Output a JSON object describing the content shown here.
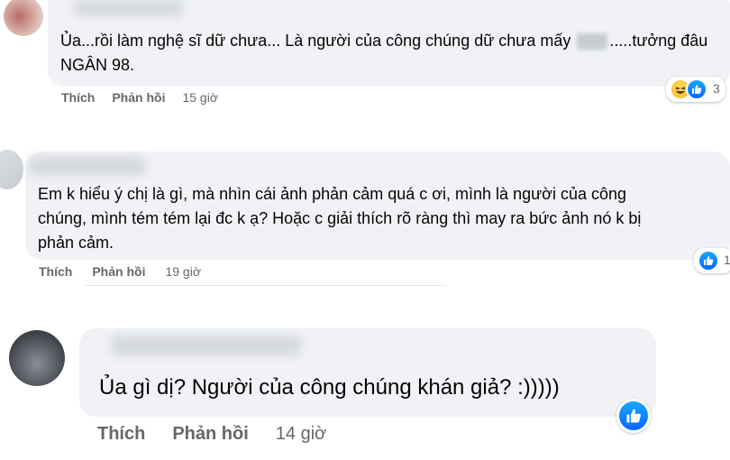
{
  "comments": [
    {
      "text_line1": "Ủa...rồi làm nghệ sĩ dữ chưa... Là người của công chúng dữ chưa mấy",
      "text_line1_after": ".....tưởng đâu",
      "text_line2": "NGÂN 98.",
      "like_label": "Thích",
      "reply_label": "Phản hồi",
      "time": "15 giờ",
      "reactions": [
        "haha",
        "like"
      ],
      "reaction_count": "3"
    },
    {
      "text_line1": "Em k hiểu ý chị là gì, mà nhìn cái ảnh phản cảm quá c ơi, mình là người của công",
      "text_line2": "chúng, mình tém tém lại đc k ạ? Hoặc c giải thích rõ ràng thì may ra bức ảnh nó k bị",
      "text_line3": "phản cảm.",
      "like_label": "Thích",
      "reply_label": "Phản hồi",
      "time": "19 giờ",
      "reactions": [
        "like"
      ],
      "reaction_count": "1"
    },
    {
      "text_line1": "Ủa gì dị? Người của công chúng khán giả? :)))))",
      "like_label": "Thích",
      "reply_label": "Phản hồi",
      "time": "14 giờ",
      "reactions": [
        "like"
      ]
    }
  ],
  "colors": {
    "bubble": "#f0f2f5",
    "text": "#050505",
    "meta": "#65676b",
    "like_blue": "#0866ff"
  }
}
